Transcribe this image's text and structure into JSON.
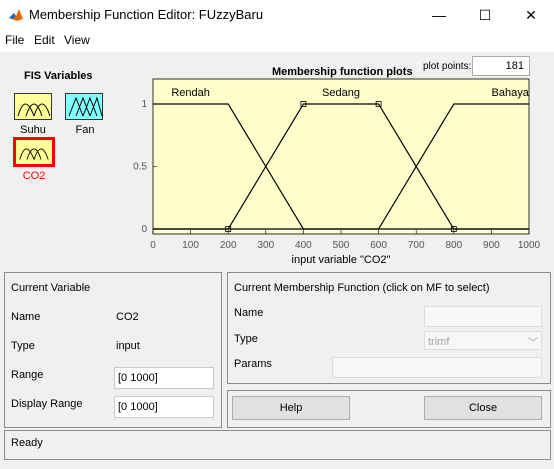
{
  "window": {
    "title": "Membership Function Editor: FUzzyBaru",
    "minimize": "—",
    "maximize": "☐",
    "close": "✕",
    "icon": "matlab-icon"
  },
  "menu": [
    "File",
    "Edit",
    "View"
  ],
  "fis_variables": {
    "title": "FIS Variables",
    "inputs": [
      "Suhu",
      "CO2"
    ],
    "outputs": [
      "Fan"
    ],
    "selected": "CO2",
    "colors": {
      "input": "#ffff99",
      "output": "#80ffff",
      "selected_border": "#ff0000",
      "selected_label": "#ff0000"
    }
  },
  "plot": {
    "title": "Membership function plots",
    "plot_points_label": "plot points:",
    "plot_points_value": "181"
  },
  "chart_data": {
    "type": "line",
    "title": "Membership function plots",
    "xlabel": "input variable \"CO2\"",
    "ylabel": "",
    "xlim": [
      0,
      1000
    ],
    "ylim": [
      0,
      1
    ],
    "xticks": [
      0,
      100,
      200,
      300,
      400,
      500,
      600,
      700,
      800,
      900,
      1000
    ],
    "yticks": [
      0,
      0.5,
      1
    ],
    "series": [
      {
        "name": "Rendah",
        "x": [
          0,
          200,
          400,
          1000
        ],
        "y": [
          1,
          1,
          0,
          0
        ]
      },
      {
        "name": "Sedang",
        "x": [
          0,
          200,
          400,
          600,
          800,
          1000
        ],
        "y": [
          0,
          0,
          1,
          1,
          0,
          0
        ]
      },
      {
        "name": "Bahaya",
        "x": [
          0,
          600,
          800,
          1000
        ],
        "y": [
          0,
          0,
          1,
          1
        ]
      }
    ],
    "label_x": [
      100,
      500,
      950
    ],
    "markers": [
      [
        200,
        0
      ],
      [
        400,
        1
      ],
      [
        600,
        1
      ],
      [
        800,
        0
      ]
    ],
    "background": "#ffffcc"
  },
  "current_variable": {
    "header": "Current Variable",
    "name_label": "Name",
    "name_value": "CO2",
    "type_label": "Type",
    "type_value": "input",
    "range_label": "Range",
    "range_value": "[0 1000]",
    "display_range_label": "Display Range",
    "display_range_value": "[0 1000]"
  },
  "current_mf": {
    "header": "Current Membership Function (click on MF to select)",
    "name_label": "Name",
    "name_value": "",
    "type_label": "Type",
    "type_value": "trimf",
    "params_label": "Params",
    "params_value": ""
  },
  "buttons": {
    "help": "Help",
    "close": "Close"
  },
  "status": "Ready"
}
